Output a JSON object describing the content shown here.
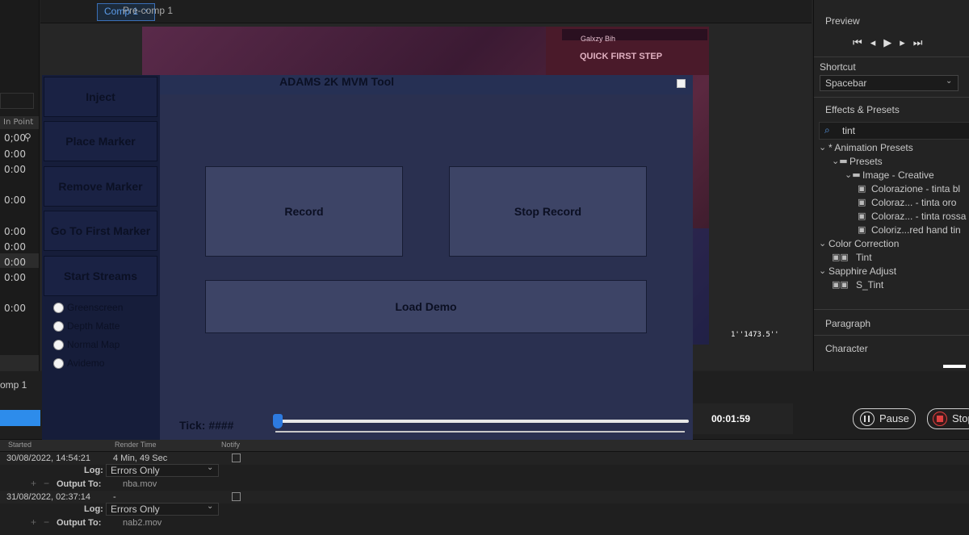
{
  "ae": {
    "tabs": [
      "Comp 1",
      "Pre-comp 1"
    ],
    "left_column": {
      "header": "In Point",
      "values": [
        "0;00",
        "0:00",
        "0:00",
        "0:00",
        "0:00",
        "0:00",
        "0:00",
        "0:00",
        "0:00"
      ]
    },
    "right_panel": {
      "preview_title": "Preview",
      "shortcut_title": "Shortcut",
      "shortcut_value": "Spacebar",
      "effects_title": "Effects & Presets",
      "search_value": "tint",
      "tree": [
        {
          "label": "* Animation Presets",
          "depth": 0,
          "kind": "folder-open"
        },
        {
          "label": "Presets",
          "depth": 1,
          "kind": "folder"
        },
        {
          "label": "Image - Creative",
          "depth": 2,
          "kind": "folder"
        },
        {
          "label": "Colorazione - tinta bl",
          "depth": 3,
          "kind": "preset"
        },
        {
          "label": "Coloraz... - tinta oro",
          "depth": 3,
          "kind": "preset"
        },
        {
          "label": "Coloraz... - tinta rossa",
          "depth": 3,
          "kind": "preset"
        },
        {
          "label": "Coloriz...red hand tin",
          "depth": 3,
          "kind": "preset"
        },
        {
          "label": "Color Correction",
          "depth": 0,
          "kind": "group"
        },
        {
          "label": "Tint",
          "depth": 1,
          "kind": "effect"
        },
        {
          "label": "Sapphire Adjust",
          "depth": 0,
          "kind": "group"
        },
        {
          "label": "S_Tint",
          "depth": 1,
          "kind": "effect"
        }
      ],
      "paragraph_title": "Paragraph",
      "character_title": "Character"
    },
    "render_queue": {
      "comp_label": "omp 1",
      "elapsed": "00:01:59",
      "pause_label": "Pause",
      "stop_label": "Stop",
      "columns": [
        "Started",
        "Render Time",
        "Notify"
      ],
      "items": [
        {
          "started": "30/08/2022, 14:54:21",
          "render_time": "4 Min, 49 Sec",
          "log_label": "Log:",
          "log_value": "Errors Only",
          "output_label": "Output To:",
          "output_value": "nba.mov"
        },
        {
          "started": "31/08/2022, 02:37:14",
          "render_time": "-",
          "log_label": "Log:",
          "log_value": "Errors Only",
          "output_label": "Output To:",
          "output_value": "nab2.mov"
        }
      ]
    },
    "video_overlay": {
      "top_text": "QUICK FIRST STEP",
      "player_name": "Galxzy Bih",
      "stats_bottom": "1''1473.5''"
    }
  },
  "tool": {
    "title": "ADAMS 2K MVM Tool",
    "side_buttons": [
      "Inject",
      "Place Marker",
      "Remove Marker",
      "Go To First Marker",
      "Start Streams"
    ],
    "radio_options": [
      "Greenscreen",
      "Depth Matte",
      "Normal Map",
      "Avidemo"
    ],
    "record_label": "Record",
    "stop_record_label": "Stop Record",
    "load_demo_label": "Load Demo",
    "tick_label": "Tick: ####",
    "slider_value": 0
  }
}
